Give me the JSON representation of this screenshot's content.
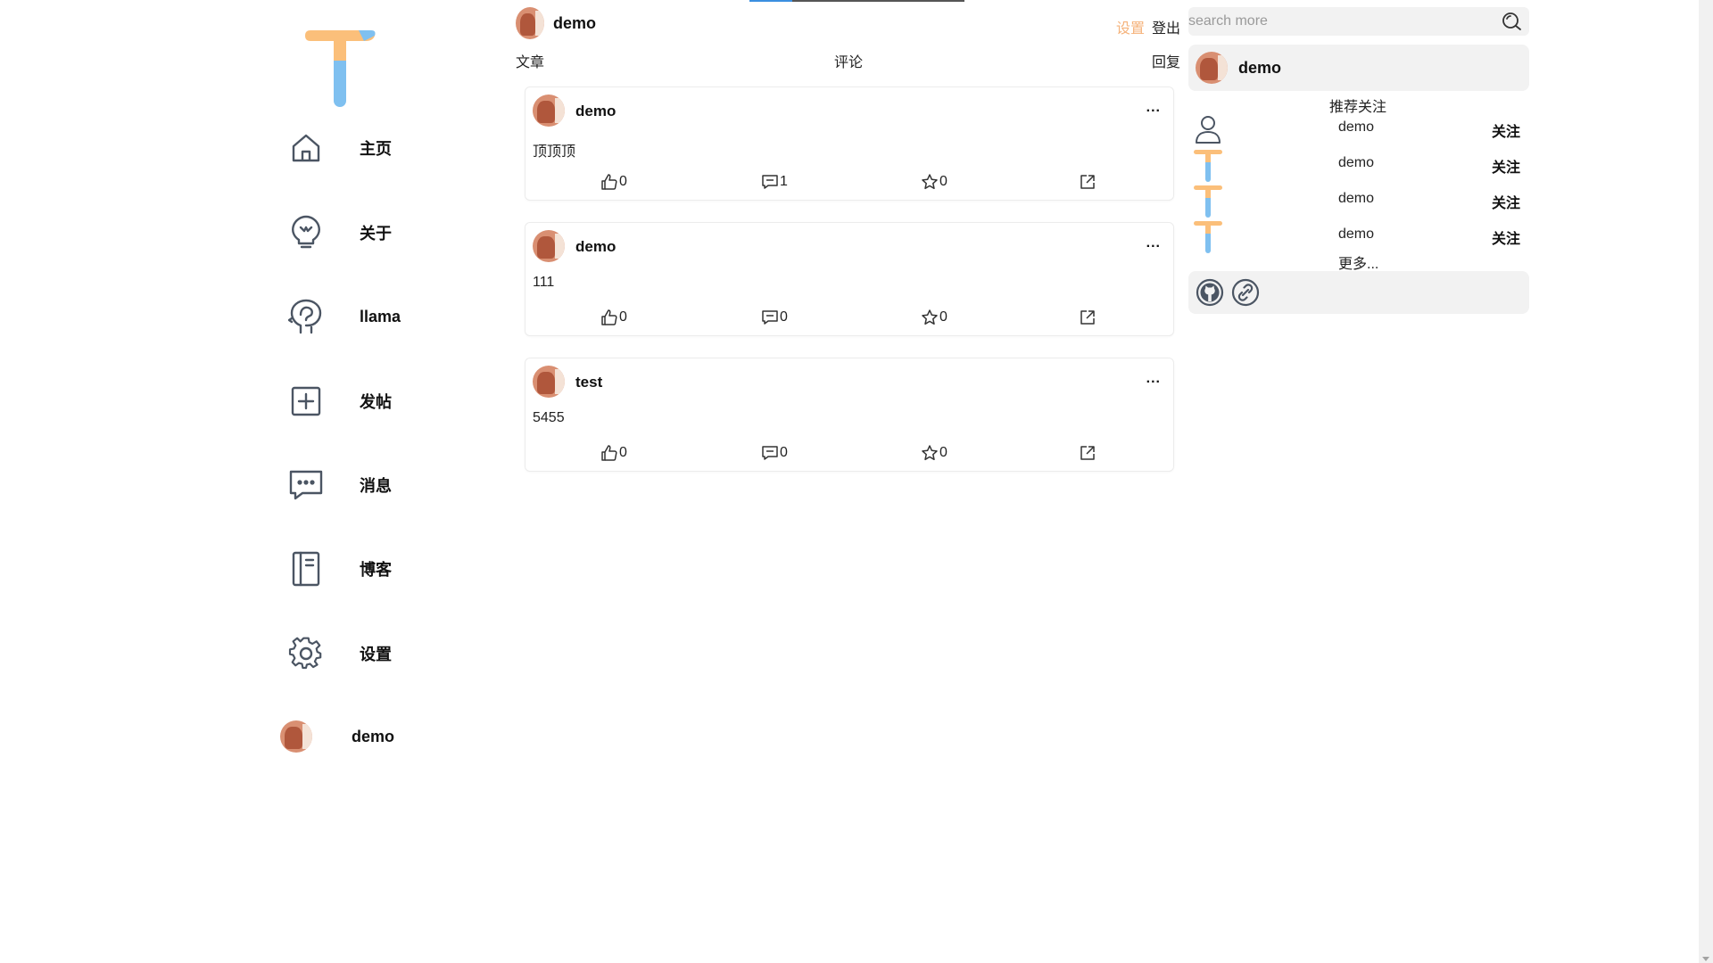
{
  "user": {
    "name": "demo"
  },
  "header": {
    "settings_label": "设置",
    "logout_label": "登出"
  },
  "colors": {
    "accent_orange": "#f5b27a",
    "accent_blue": "#7fc0f0",
    "icon_gray": "#4b5563",
    "tab_active": "#3b8fe0"
  },
  "logo": {
    "icon": "t-logo-icon"
  },
  "nav": {
    "items": [
      {
        "label": "主页",
        "icon": "home-icon"
      },
      {
        "label": "关于",
        "icon": "lightbulb-icon"
      },
      {
        "label": "llama",
        "icon": "brain-head-icon"
      },
      {
        "label": "发帖",
        "icon": "plus-square-icon"
      },
      {
        "label": "消息",
        "icon": "message-icon"
      },
      {
        "label": "博客",
        "icon": "notebook-icon"
      },
      {
        "label": "设置",
        "icon": "gear-icon"
      },
      {
        "label": "demo",
        "icon": "avatar"
      }
    ]
  },
  "tabs": [
    {
      "label": "文章"
    },
    {
      "label": "评论"
    },
    {
      "label": "回复"
    }
  ],
  "posts": [
    {
      "author": "demo",
      "content": "顶顶顶",
      "likes": "0",
      "comments": "1",
      "stars": "0",
      "more": "..."
    },
    {
      "author": "demo",
      "content": "111",
      "likes": "0",
      "comments": "0",
      "stars": "0",
      "more": "..."
    },
    {
      "author": "test",
      "content": "5455",
      "likes": "0",
      "comments": "0",
      "stars": "0",
      "more": "..."
    }
  ],
  "search": {
    "placeholder": "search more",
    "value": ""
  },
  "profile_card": {
    "name": "demo"
  },
  "recommend": {
    "title": "推荐关注",
    "users": [
      {
        "name": "demo",
        "follow_label": "关注",
        "icon": "user-outline-icon"
      },
      {
        "name": "demo",
        "follow_label": "关注",
        "icon": "t-logo-icon"
      },
      {
        "name": "demo",
        "follow_label": "关注",
        "icon": "t-logo-icon"
      },
      {
        "name": "demo",
        "follow_label": "关注",
        "icon": "t-logo-icon"
      }
    ],
    "more_label": "更多..."
  },
  "links": [
    {
      "icon": "github-icon"
    },
    {
      "icon": "link-icon"
    }
  ]
}
